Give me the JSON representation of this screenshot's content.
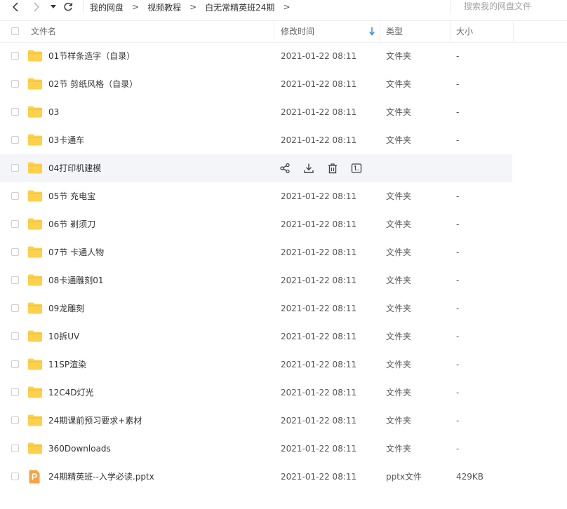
{
  "nav": {
    "breadcrumb": [
      "我的网盘",
      "视频教程",
      "白无常精英班24期"
    ],
    "crumb_separator": ">",
    "search_placeholder": "搜索我的网盘文件"
  },
  "columns": {
    "name": "文件名",
    "modified": "修改时间",
    "type": "类型",
    "size": "大小"
  },
  "files": [
    {
      "name": "01节样条造字（自录）",
      "time": "2021-01-22 08:11",
      "type": "文件夹",
      "size": "-",
      "icon": "folder-icon"
    },
    {
      "name": "02节 剪纸风格（自录）",
      "time": "2021-01-22 08:11",
      "type": "文件夹",
      "size": "-",
      "icon": "folder-icon"
    },
    {
      "name": "03",
      "time": "2021-01-22 08:11",
      "type": "文件夹",
      "size": "-",
      "icon": "folder-icon"
    },
    {
      "name": "03卡通车",
      "time": "2021-01-22 08:11",
      "type": "文件夹",
      "size": "-",
      "icon": "folder-icon"
    },
    {
      "name": "04打印机建模",
      "time": "",
      "type": "",
      "size": "",
      "icon": "folder-icon",
      "hovered": true
    },
    {
      "name": "05节 充电宝",
      "time": "2021-01-22 08:11",
      "type": "文件夹",
      "size": "-",
      "icon": "folder-icon"
    },
    {
      "name": "06节 剃须刀",
      "time": "2021-01-22 08:11",
      "type": "文件夹",
      "size": "-",
      "icon": "folder-icon"
    },
    {
      "name": "07节 卡通人物",
      "time": "2021-01-22 08:11",
      "type": "文件夹",
      "size": "-",
      "icon": "folder-icon"
    },
    {
      "name": "08卡通雕刻01",
      "time": "2021-01-22 08:11",
      "type": "文件夹",
      "size": "-",
      "icon": "folder-icon"
    },
    {
      "name": "09龙雕刻",
      "time": "2021-01-22 08:11",
      "type": "文件夹",
      "size": "-",
      "icon": "folder-icon"
    },
    {
      "name": "10拆UV",
      "time": "2021-01-22 08:11",
      "type": "文件夹",
      "size": "-",
      "icon": "folder-icon"
    },
    {
      "name": "11SP渲染",
      "time": "2021-01-22 08:11",
      "type": "文件夹",
      "size": "-",
      "icon": "folder-icon"
    },
    {
      "name": "12C4D灯光",
      "time": "2021-01-22 08:11",
      "type": "文件夹",
      "size": "-",
      "icon": "folder-icon"
    },
    {
      "name": "24期课前预习要求+素材",
      "time": "2021-01-22 08:11",
      "type": "文件夹",
      "size": "-",
      "icon": "folder-icon"
    },
    {
      "name": "360Downloads",
      "time": "2021-01-22 08:11",
      "type": "文件夹",
      "size": "-",
      "icon": "folder-icon"
    },
    {
      "name": "24期精英班--入学必读.pptx",
      "time": "2021-01-22 08:11",
      "type": "pptx文件",
      "size": "429KB",
      "icon": "pptx-file-icon"
    }
  ],
  "row_actions": [
    "share-icon",
    "download-icon",
    "delete-icon",
    "rename-icon"
  ],
  "colors": {
    "folder": "#ffd04a",
    "pptx": "#f5a444",
    "hover_row": "#f4f5f9",
    "sort_arrow": "#2f8cf0"
  }
}
